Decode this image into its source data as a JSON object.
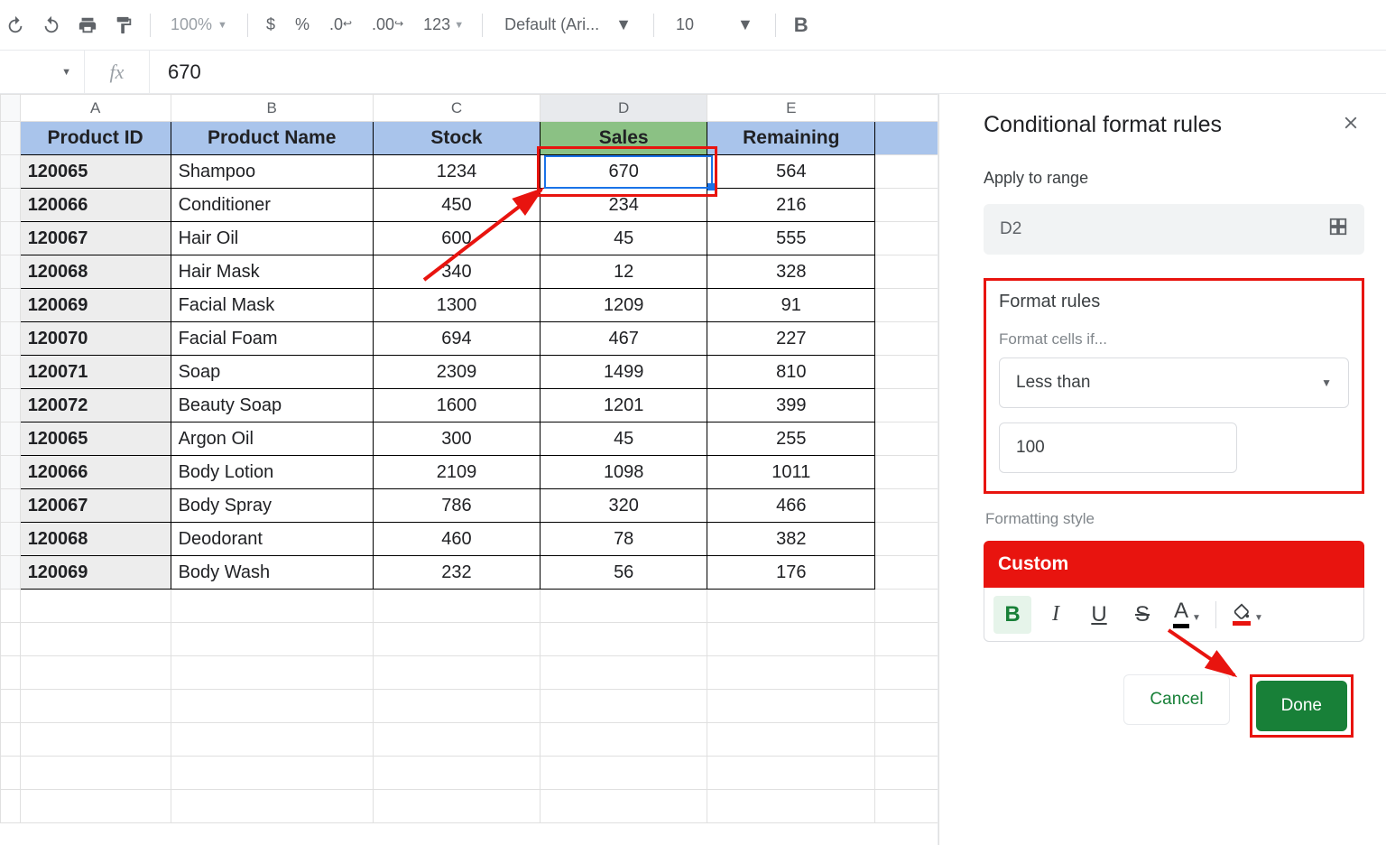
{
  "toolbar": {
    "zoom": "100%",
    "currency": "$",
    "percent": "%",
    "dec_dec": ".0",
    "inc_dec": ".00",
    "number_format": "123",
    "font": "Default (Ari...",
    "font_size": "10",
    "bold_label": "B"
  },
  "formula_bar": {
    "value": "670"
  },
  "columns": [
    "A",
    "B",
    "C",
    "D",
    "E"
  ],
  "headers": {
    "a": "Product ID",
    "b": "Product Name",
    "c": "Stock",
    "d": "Sales",
    "e": "Remaining"
  },
  "rows": [
    {
      "id": "120065",
      "name": "Shampoo",
      "stock": "1234",
      "sales": "670",
      "rem": "564"
    },
    {
      "id": "120066",
      "name": "Conditioner",
      "stock": "450",
      "sales": "234",
      "rem": "216"
    },
    {
      "id": "120067",
      "name": "Hair Oil",
      "stock": "600",
      "sales": "45",
      "rem": "555"
    },
    {
      "id": "120068",
      "name": "Hair Mask",
      "stock": "340",
      "sales": "12",
      "rem": "328"
    },
    {
      "id": "120069",
      "name": "Facial Mask",
      "stock": "1300",
      "sales": "1209",
      "rem": "91"
    },
    {
      "id": "120070",
      "name": "Facial Foam",
      "stock": "694",
      "sales": "467",
      "rem": "227"
    },
    {
      "id": "120071",
      "name": "Soap",
      "stock": "2309",
      "sales": "1499",
      "rem": "810"
    },
    {
      "id": "120072",
      "name": "Beauty Soap",
      "stock": "1600",
      "sales": "1201",
      "rem": "399"
    },
    {
      "id": "120065",
      "name": "Argon Oil",
      "stock": "300",
      "sales": "45",
      "rem": "255"
    },
    {
      "id": "120066",
      "name": "Body Lotion",
      "stock": "2109",
      "sales": "1098",
      "rem": "1011"
    },
    {
      "id": "120067",
      "name": "Body Spray",
      "stock": "786",
      "sales": "320",
      "rem": "466"
    },
    {
      "id": "120068",
      "name": "Deodorant",
      "stock": "460",
      "sales": "78",
      "rem": "382"
    },
    {
      "id": "120069",
      "name": "Body Wash",
      "stock": "232",
      "sales": "56",
      "rem": "176"
    }
  ],
  "panel": {
    "title": "Conditional format rules",
    "range_label": "Apply to range",
    "range_value": "D2",
    "rules_title": "Format rules",
    "format_if_hint": "Format cells if...",
    "condition": "Less than",
    "condition_value": "100",
    "style_label": "Formatting style",
    "custom_label": "Custom",
    "btn_bold": "B",
    "btn_italic": "I",
    "btn_underline": "U",
    "btn_strike": "S",
    "btn_textcolor": "A",
    "cancel": "Cancel",
    "done": "Done"
  },
  "selected_cell": "D2"
}
